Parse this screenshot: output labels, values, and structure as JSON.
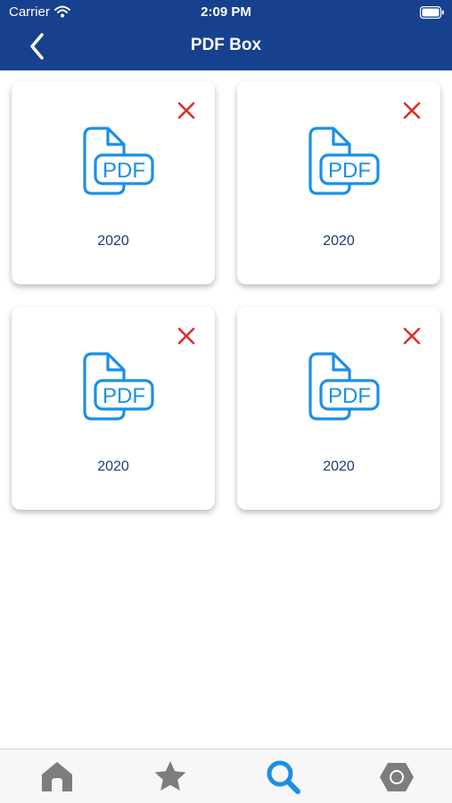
{
  "status_bar": {
    "carrier": "Carrier",
    "time": "2:09 PM"
  },
  "nav": {
    "title": "PDF Box",
    "back_icon": "chevron-left-icon"
  },
  "documents": [
    {
      "label": "2020",
      "icon": "pdf-file-icon"
    },
    {
      "label": "2020",
      "icon": "pdf-file-icon"
    },
    {
      "label": "2020",
      "icon": "pdf-file-icon"
    },
    {
      "label": "2020",
      "icon": "pdf-file-icon"
    }
  ],
  "tab_bar": {
    "tabs": [
      {
        "icon": "home-icon",
        "active": false
      },
      {
        "icon": "star-icon",
        "active": false
      },
      {
        "icon": "search-icon",
        "active": true
      },
      {
        "icon": "hexagon-settings-icon",
        "active": false
      }
    ]
  },
  "colors": {
    "header": "#17418e",
    "pdf_icon": "#1a8fe6",
    "delete": "#d9302a",
    "year_text": "#1e3a78",
    "tab_inactive": "#7d7d7d",
    "tab_active": "#1a8fe6"
  }
}
